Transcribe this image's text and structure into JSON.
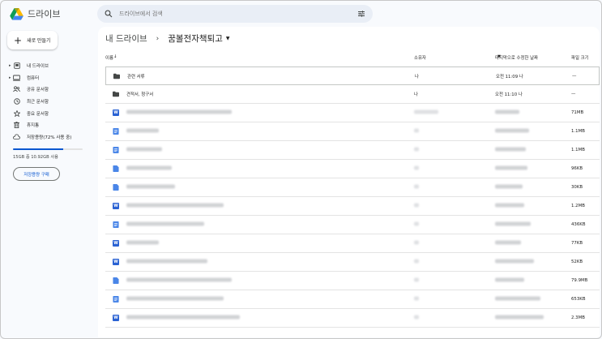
{
  "app": {
    "title": "드라이브"
  },
  "search": {
    "placeholder": "드라이브에서 검색"
  },
  "sidebar": {
    "new_label": "새로 만들기",
    "items": [
      {
        "label": "내 드라이브",
        "icon": "my-drive-icon",
        "expandable": true
      },
      {
        "label": "컴퓨터",
        "icon": "computer-icon",
        "expandable": true
      },
      {
        "label": "공유 문서함",
        "icon": "shared-icon",
        "expandable": false
      },
      {
        "label": "최근 문서함",
        "icon": "clock-icon",
        "expandable": false
      },
      {
        "label": "중요 문서함",
        "icon": "star-icon",
        "expandable": false
      },
      {
        "label": "휴지통",
        "icon": "trash-icon",
        "expandable": false
      },
      {
        "label": "저장용량(72% 사용 중)",
        "icon": "cloud-icon",
        "expandable": false
      }
    ],
    "storage_fraction": 0.72,
    "storage_text": "15GB 중 10.92GB 사용",
    "buy_label": "저장용량 구매"
  },
  "breadcrumb": {
    "root": "내 드라이브",
    "separator": "›",
    "current": "꿈볼전자책퇴고"
  },
  "table": {
    "headers": {
      "name": "이름",
      "owner": "소유자",
      "modified": "마지막으로 수정한 날짜",
      "size": "파일 크기"
    },
    "rows": [
      {
        "type": "folder",
        "name": "관련 서류",
        "owner": "나",
        "modified": "오전 11:09 나",
        "size": "—"
      },
      {
        "type": "folder",
        "name": "견적서, 청구서",
        "owner": "나",
        "modified": "오전 11:10 나",
        "size": "—"
      },
      {
        "type": "word",
        "name": "",
        "owner": "",
        "modified": "",
        "size": "71MB"
      },
      {
        "type": "doc",
        "name": "",
        "owner": "",
        "modified": "",
        "size": "1.1MB"
      },
      {
        "type": "doc",
        "name": "",
        "owner": "",
        "modified": "",
        "size": "1.1MB"
      },
      {
        "type": "file",
        "name": "",
        "owner": "",
        "modified": "",
        "size": "96KB"
      },
      {
        "type": "file",
        "name": "",
        "owner": "",
        "modified": "",
        "size": "30KB"
      },
      {
        "type": "word",
        "name": "",
        "owner": "",
        "modified": "",
        "size": "1.2MB"
      },
      {
        "type": "doc",
        "name": "",
        "owner": "",
        "modified": "",
        "size": "436KB"
      },
      {
        "type": "word",
        "name": "",
        "owner": "",
        "modified": "",
        "size": "77KB"
      },
      {
        "type": "word",
        "name": "",
        "owner": "",
        "modified": "",
        "size": "52KB"
      },
      {
        "type": "file",
        "name": "",
        "owner": "",
        "modified": "",
        "size": "79.9MB"
      },
      {
        "type": "doc",
        "name": "",
        "owner": "",
        "modified": "",
        "size": "653KB"
      },
      {
        "type": "word",
        "name": "",
        "owner": "",
        "modified": "",
        "size": "2.3MB"
      }
    ]
  },
  "colors": {
    "accent": "#0b57d0",
    "folder": "#444746",
    "word": "#2a62d3",
    "doc": "#4a86e8"
  }
}
